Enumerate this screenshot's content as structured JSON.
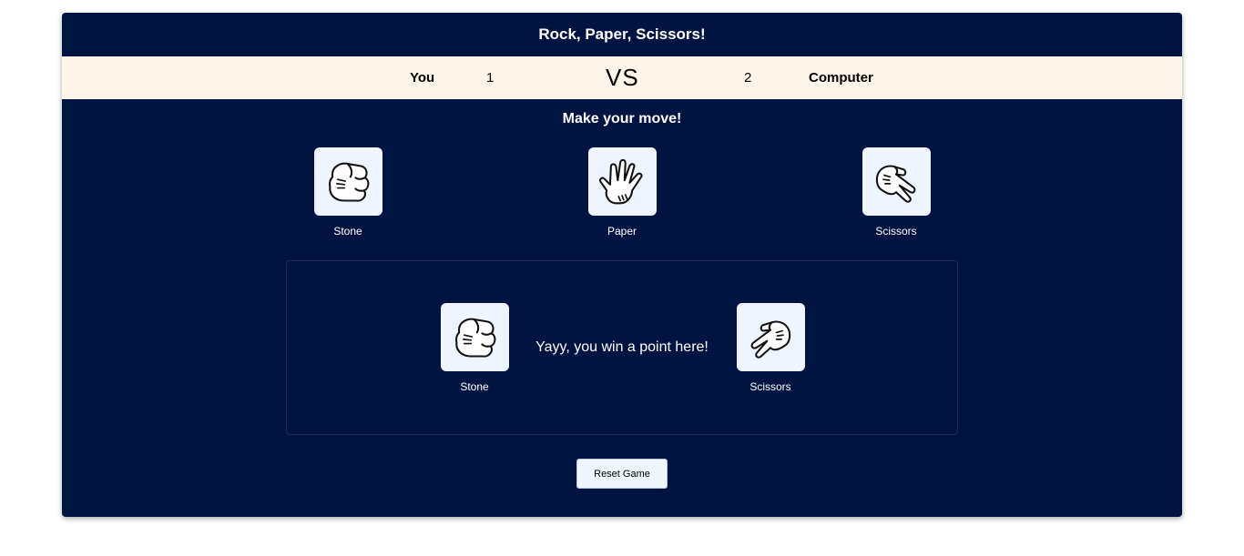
{
  "app": {
    "title": "Rock, Paper, Scissors!"
  },
  "scoreboard": {
    "player_label": "You",
    "player_score": "1",
    "vs_label": "VS",
    "computer_score": "2",
    "computer_label": "Computer"
  },
  "prompt": "Make your move!",
  "choices": [
    {
      "label": "Stone",
      "icon": "fist-icon"
    },
    {
      "label": "Paper",
      "icon": "open-hand-icon"
    },
    {
      "label": "Scissors",
      "icon": "scissors-hand-icon"
    }
  ],
  "result": {
    "player_choice": "Stone",
    "player_icon": "fist-icon",
    "message": "Yayy, you win a point here!",
    "computer_choice": "Scissors",
    "computer_icon": "scissors-hand-icon"
  },
  "reset_label": "Reset Game",
  "colors": {
    "background": "#001442",
    "score_bar": "#fdf5ea",
    "tile": "#eef5ff"
  }
}
